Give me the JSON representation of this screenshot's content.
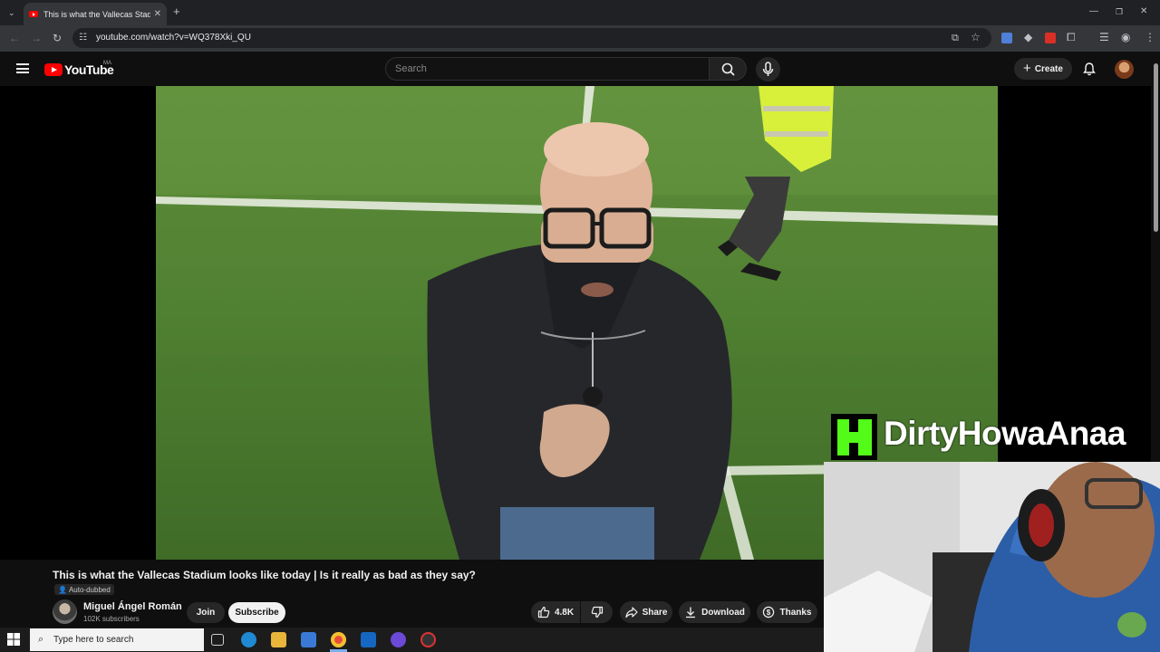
{
  "browser": {
    "tab_title": "This is what the Vallecas Stadium",
    "tab_close": "✕",
    "new_tab": "+",
    "url": "youtube.com/watch?v=WQ378Xki_QU"
  },
  "youtube": {
    "logo_text": "YouTube",
    "country_code": "MA",
    "search_placeholder": "Search",
    "create_label": "Create"
  },
  "video": {
    "title": "This is what the Vallecas Stadium looks like today | Is it really as bad as they say?",
    "auto_dubbed": "Auto-dubbed"
  },
  "channel": {
    "name": "Miguel Ángel Román",
    "subscribers": "102K subscribers",
    "join_label": "Join",
    "subscribe_label": "Subscribe"
  },
  "actions": {
    "likes": "4.8K",
    "share_label": "Share",
    "download_label": "Download",
    "thanks_label": "Thanks"
  },
  "overlay": {
    "streamer_name": "DirtyHowaAnaa"
  },
  "taskbar": {
    "search_placeholder": "Type here to search"
  },
  "colors": {
    "youtube_red": "#ff0000",
    "kick_green": "#53fc18",
    "page_bg": "#0f0f0f"
  }
}
